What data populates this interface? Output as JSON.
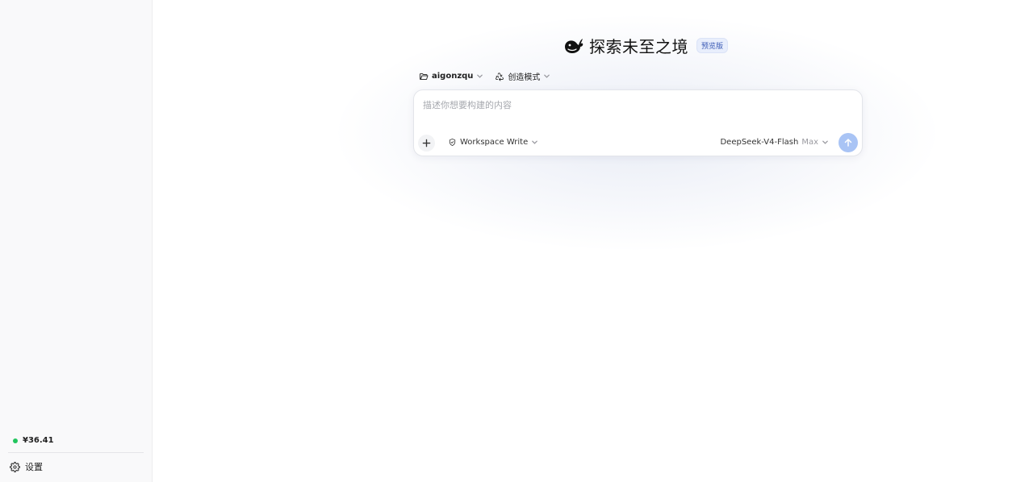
{
  "sidebar": {
    "balance": "¥36.41",
    "settings_label": "设置",
    "status_color": "#22c55e"
  },
  "header": {
    "title": "探索未至之境",
    "badge": "预览版"
  },
  "toolbar": {
    "project": "aigonzqu",
    "mode": "创造模式"
  },
  "composer": {
    "placeholder": "描述你想要构建的内容",
    "value": "",
    "permission_mode": "Workspace Write",
    "model": "DeepSeek-V4-Flash",
    "tier": "Max"
  },
  "icons": {
    "logo": "whale-icon",
    "project": "folder-icon",
    "mode": "recycle-icon",
    "permission": "shield-icon",
    "add": "plus-icon",
    "send": "arrow-up-icon",
    "settings": "gear-icon"
  },
  "colors": {
    "accent": "#a9c4f5",
    "badge_bg": "#e8eefc",
    "badge_text": "#3b5bb5"
  }
}
